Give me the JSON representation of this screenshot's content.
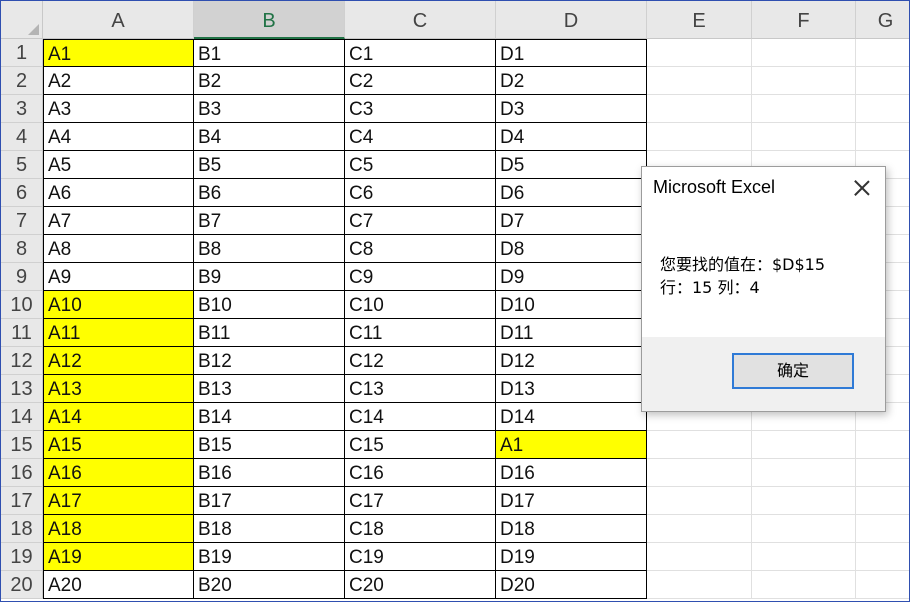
{
  "columns": [
    "A",
    "B",
    "C",
    "D",
    "E",
    "F",
    "G"
  ],
  "selected_column": "B",
  "rows": [
    {
      "n": "1",
      "cells": [
        "A1",
        "B1",
        "C1",
        "D1"
      ],
      "highlight": [
        0
      ]
    },
    {
      "n": "2",
      "cells": [
        "A2",
        "B2",
        "C2",
        "D2"
      ],
      "highlight": []
    },
    {
      "n": "3",
      "cells": [
        "A3",
        "B3",
        "C3",
        "D3"
      ],
      "highlight": []
    },
    {
      "n": "4",
      "cells": [
        "A4",
        "B4",
        "C4",
        "D4"
      ],
      "highlight": []
    },
    {
      "n": "5",
      "cells": [
        "A5",
        "B5",
        "C5",
        "D5"
      ],
      "highlight": []
    },
    {
      "n": "6",
      "cells": [
        "A6",
        "B6",
        "C6",
        "D6"
      ],
      "highlight": []
    },
    {
      "n": "7",
      "cells": [
        "A7",
        "B7",
        "C7",
        "D7"
      ],
      "highlight": []
    },
    {
      "n": "8",
      "cells": [
        "A8",
        "B8",
        "C8",
        "D8"
      ],
      "highlight": []
    },
    {
      "n": "9",
      "cells": [
        "A9",
        "B9",
        "C9",
        "D9"
      ],
      "highlight": []
    },
    {
      "n": "10",
      "cells": [
        "A10",
        "B10",
        "C10",
        "D10"
      ],
      "highlight": [
        0
      ]
    },
    {
      "n": "11",
      "cells": [
        "A11",
        "B11",
        "C11",
        "D11"
      ],
      "highlight": [
        0
      ]
    },
    {
      "n": "12",
      "cells": [
        "A12",
        "B12",
        "C12",
        "D12"
      ],
      "highlight": [
        0
      ]
    },
    {
      "n": "13",
      "cells": [
        "A13",
        "B13",
        "C13",
        "D13"
      ],
      "highlight": [
        0
      ]
    },
    {
      "n": "14",
      "cells": [
        "A14",
        "B14",
        "C14",
        "D14"
      ],
      "highlight": [
        0
      ]
    },
    {
      "n": "15",
      "cells": [
        "A15",
        "B15",
        "C15",
        "A1"
      ],
      "highlight": [
        0,
        3
      ]
    },
    {
      "n": "16",
      "cells": [
        "A16",
        "B16",
        "C16",
        "D16"
      ],
      "highlight": [
        0
      ]
    },
    {
      "n": "17",
      "cells": [
        "A17",
        "B17",
        "C17",
        "D17"
      ],
      "highlight": [
        0
      ]
    },
    {
      "n": "18",
      "cells": [
        "A18",
        "B18",
        "C18",
        "D18"
      ],
      "highlight": [
        0
      ]
    },
    {
      "n": "19",
      "cells": [
        "A19",
        "B19",
        "C19",
        "D19"
      ],
      "highlight": [
        0
      ]
    },
    {
      "n": "20",
      "cells": [
        "A20",
        "B20",
        "C20",
        "D20"
      ],
      "highlight": []
    }
  ],
  "colors": {
    "highlight": "#ffff00",
    "selected_header_text": "#217346",
    "button_border": "#2f7ad6"
  },
  "dialog": {
    "title": "Microsoft Excel",
    "message_line1": "您要找的值在：$D$15",
    "message_line2": "行：15 列：4",
    "ok_label": "确定",
    "close_icon": "close-icon"
  }
}
